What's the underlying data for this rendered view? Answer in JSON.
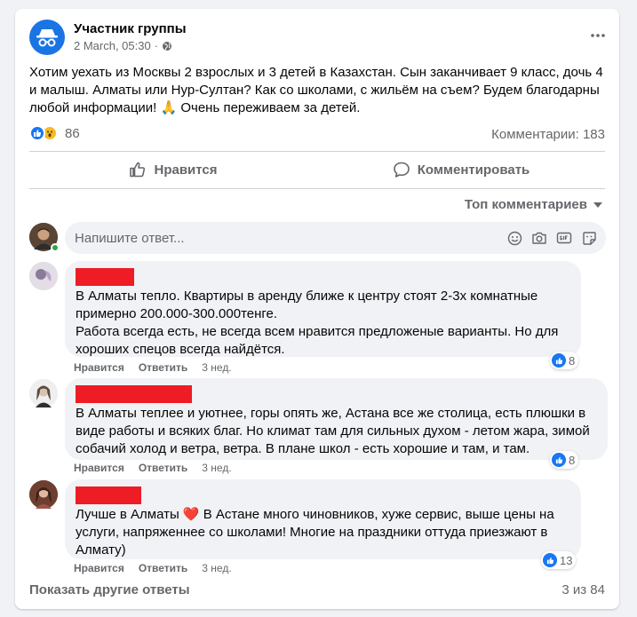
{
  "post": {
    "author": "Участник группы",
    "date": "2 March, 05:30",
    "separator": "·",
    "text": "Хотим уехать из Москвы 2 взрослых и 3 детей в Казахстан. Сын заканчивает 9 класс, дочь 4 и малыш. Алматы или Нур-Султан? Как со школами, с жильём на съем? Будем благодарны любой информации! 🙏 Очень переживаем за детей.",
    "reaction_count": "86",
    "comments_count": "Комментарии: 183"
  },
  "actions": {
    "like": "Нравится",
    "comment": "Комментировать"
  },
  "sort_label": "Топ комментариев",
  "reply": {
    "placeholder": "Напишите ответ..."
  },
  "comments": [
    {
      "text": "В Алматы тепло. Квартиры в аренду ближе к центру стоят 2-3х комнатные примерно 200.000-300.000тенге.\nРабота всегда есть, не всегда всем нравится предложеные варианты. Но для хороших спецов всегда найдётся.",
      "like": "Нравится",
      "reply": "Ответить",
      "time": "3 нед.",
      "reactions": "8"
    },
    {
      "text": "В Алматы теплее и уютнее, горы опять же, Астана все же столица, есть плюшки в виде работы и всяких благ. Но климат там для сильных духом - летом жара, зимой собачий холод и ветра, ветра. В плане школ - есть хорошие и там, и там.",
      "like": "Нравится",
      "reply": "Ответить",
      "time": "3 нед.",
      "reactions": "8"
    },
    {
      "text": "Лучше в Алматы ❤️ В Астане много чиновников, хуже сервис, выше цены на услуги, напряженнее со школами! Многие на праздники оттуда приезжают в Алмату)",
      "like": "Нравится",
      "reply": "Ответить",
      "time": "3 нед.",
      "reactions": "13"
    }
  ],
  "footer": {
    "show_more": "Показать другие ответы",
    "pager": "3 из 84"
  },
  "colors": {
    "accent": "#1877f2",
    "redaction": "#ee1c24",
    "bubble": "#f0f2f5",
    "secondary_text": "#65676b"
  }
}
